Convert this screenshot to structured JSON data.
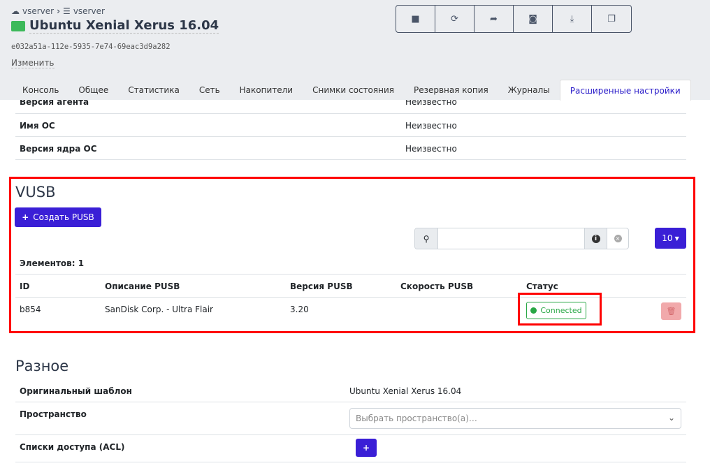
{
  "breadcrumb": {
    "items": [
      "vserver",
      "vserver"
    ]
  },
  "header": {
    "title": "Ubuntu Xenial Xerus 16.04",
    "uuid": "e032a51a-112e-5935-7e74-69eac3d9a282",
    "edit_label": "Изменить"
  },
  "toolbar": [
    {
      "icon": "stop-icon"
    },
    {
      "icon": "refresh-icon"
    },
    {
      "icon": "share-icon"
    },
    {
      "icon": "camera-icon"
    },
    {
      "icon": "download-icon"
    },
    {
      "icon": "clone-icon"
    }
  ],
  "tabs": [
    {
      "label": "Консоль"
    },
    {
      "label": "Общее"
    },
    {
      "label": "Статистика"
    },
    {
      "label": "Сеть"
    },
    {
      "label": "Накопители"
    },
    {
      "label": "Снимки состояния"
    },
    {
      "label": "Резервная копия"
    },
    {
      "label": "Журналы"
    },
    {
      "label": "Расширенные настройки",
      "active": true
    }
  ],
  "info_rows": [
    {
      "key": "Версия агента",
      "value": "Неизвестно"
    },
    {
      "key": "Имя ОС",
      "value": "Неизвестно"
    },
    {
      "key": "Версия ядра ОС",
      "value": "Неизвестно"
    }
  ],
  "vusb": {
    "title": "VUSB",
    "create_label": "Создать PUSB",
    "search_value": "",
    "page_size": "10",
    "count_label": "Элементов: 1",
    "columns": [
      "ID",
      "Описание PUSB",
      "Версия PUSB",
      "Скорость PUSB",
      "Статус"
    ],
    "rows": [
      {
        "id": "b854",
        "description": "SanDisk Corp. - Ultra Flair",
        "version": "3.20",
        "speed": "",
        "status": "Connected"
      }
    ],
    "status_color": "#28a745"
  },
  "misc": {
    "title": "Разное",
    "template_label": "Оригинальный шаблон",
    "template_value": "Ubuntu Xenial Xerus 16.04",
    "space_label": "Пространство",
    "space_placeholder": "Выбрать пространство(а)…",
    "acl_label": "Списки доступа (ACL)"
  },
  "colors": {
    "accent": "#3a1fd6",
    "highlight": "#ff0000"
  }
}
